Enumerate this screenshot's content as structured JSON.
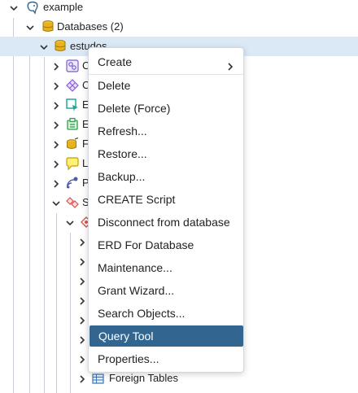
{
  "tree": {
    "server": {
      "label": "example",
      "icon": "postgres-elephant-icon"
    },
    "databases": {
      "label": "Databases (2)",
      "icon": "databases-icon"
    },
    "db": {
      "label": "estudos",
      "icon": "database-icon"
    },
    "children": [
      {
        "label": "C",
        "icon": "casts-icon"
      },
      {
        "label": "C",
        "icon": "catalogs-icon"
      },
      {
        "label": "E",
        "icon": "event-triggers-icon"
      },
      {
        "label": "E",
        "icon": "extensions-icon"
      },
      {
        "label": "F",
        "icon": "foreign-data-wrappers-icon"
      },
      {
        "label": "L",
        "icon": "languages-icon"
      },
      {
        "label": "P",
        "icon": "publications-icon"
      },
      {
        "label": "S",
        "icon": "schemas-icon"
      }
    ],
    "schema_node": {
      "icon": "schema-icon"
    },
    "foreign_tables": {
      "label": "Foreign Tables",
      "icon": "foreign-table-icon"
    }
  },
  "context_menu": {
    "items": [
      {
        "label": "Create",
        "has_submenu": true
      },
      {
        "label": "Delete"
      },
      {
        "label": "Delete (Force)"
      },
      {
        "label": "Refresh..."
      },
      {
        "label": "Restore..."
      },
      {
        "label": "Backup..."
      },
      {
        "label": "CREATE Script"
      },
      {
        "label": "Disconnect from database"
      },
      {
        "label": "ERD For Database"
      },
      {
        "label": "Maintenance..."
      },
      {
        "label": "Grant Wizard..."
      },
      {
        "label": "Search Objects..."
      },
      {
        "label": "Query Tool",
        "highlighted": true
      },
      {
        "label": "Properties..."
      }
    ]
  },
  "colors": {
    "selection_bg": "#dbe9f7",
    "menu_highlight": "#326690"
  }
}
